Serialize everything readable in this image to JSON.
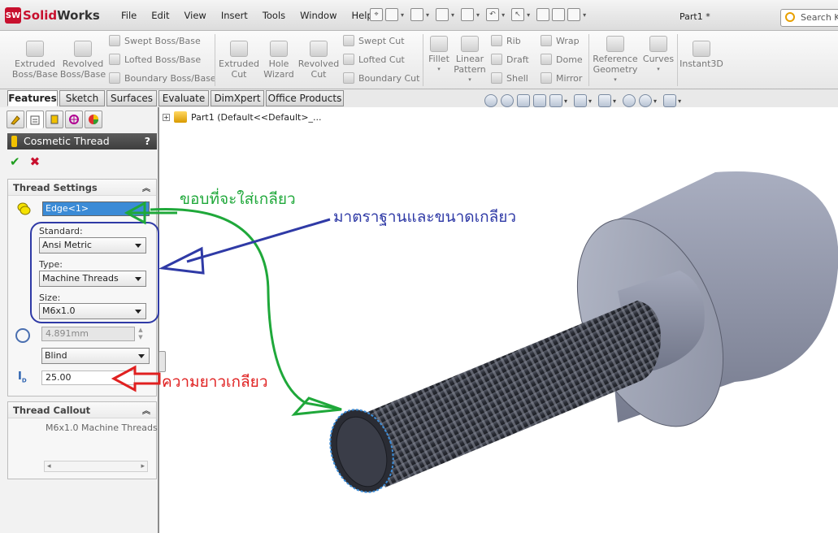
{
  "app": {
    "logo_prefix": "Solid",
    "logo_suffix": "Works",
    "logo_mark": "SW",
    "document_title": "Part1 *",
    "search_placeholder": "Search K"
  },
  "menu": [
    "File",
    "Edit",
    "View",
    "Insert",
    "Tools",
    "Window",
    "Help"
  ],
  "ribbon": {
    "extruded_boss": "Extruded\nBoss/Base",
    "revolved_boss": "Revolved\nBoss/Base",
    "swept_boss": "Swept Boss/Base",
    "lofted_boss": "Lofted Boss/Base",
    "boundary_boss": "Boundary Boss/Base",
    "extruded_cut": "Extruded\nCut",
    "hole_wizard": "Hole\nWizard",
    "revolved_cut": "Revolved\nCut",
    "swept_cut": "Swept Cut",
    "lofted_cut": "Lofted Cut",
    "boundary_cut": "Boundary Cut",
    "fillet": "Fillet",
    "linear_pattern": "Linear\nPattern",
    "rib": "Rib",
    "draft": "Draft",
    "shell": "Shell",
    "wrap": "Wrap",
    "dome": "Dome",
    "mirror": "Mirror",
    "reference_geometry": "Reference\nGeometry",
    "curves": "Curves",
    "instant3d": "Instant3D"
  },
  "tabs": [
    "Features",
    "Sketch",
    "Surfaces",
    "Evaluate",
    "DimXpert",
    "Office Products"
  ],
  "active_tab": "Features",
  "tree": {
    "root": "Part1  (Default<<Default>_..."
  },
  "panel": {
    "title": "Cosmetic Thread",
    "help": "?",
    "ok_symbol": "✔",
    "cancel_symbol": "✖",
    "thread_settings": {
      "header": "Thread Settings",
      "edge": "Edge<1>",
      "standard_label": "Standard:",
      "standard": "Ansi Metric",
      "type_label": "Type:",
      "type": "Machine Threads",
      "size_label": "Size:",
      "size": "M6x1.0",
      "diameter": "4.891mm",
      "end_condition": "Blind",
      "depth": "25.00"
    },
    "thread_callout": {
      "header": "Thread Callout",
      "text": "M6x1.0 Machine Threads"
    }
  },
  "annotations": {
    "edge_label": "ขอบที่จะใส่เกลียว",
    "standard_size_label": "มาตราฐานและขนาดเกลียว",
    "length_label": "ความยาวเกลียว"
  },
  "colors": {
    "annotation_green": "#1fa83a",
    "annotation_blue": "#2f3aa6",
    "annotation_red": "#e02020",
    "selection_blue": "#3b8bd6",
    "brand_red": "#c8102e"
  }
}
